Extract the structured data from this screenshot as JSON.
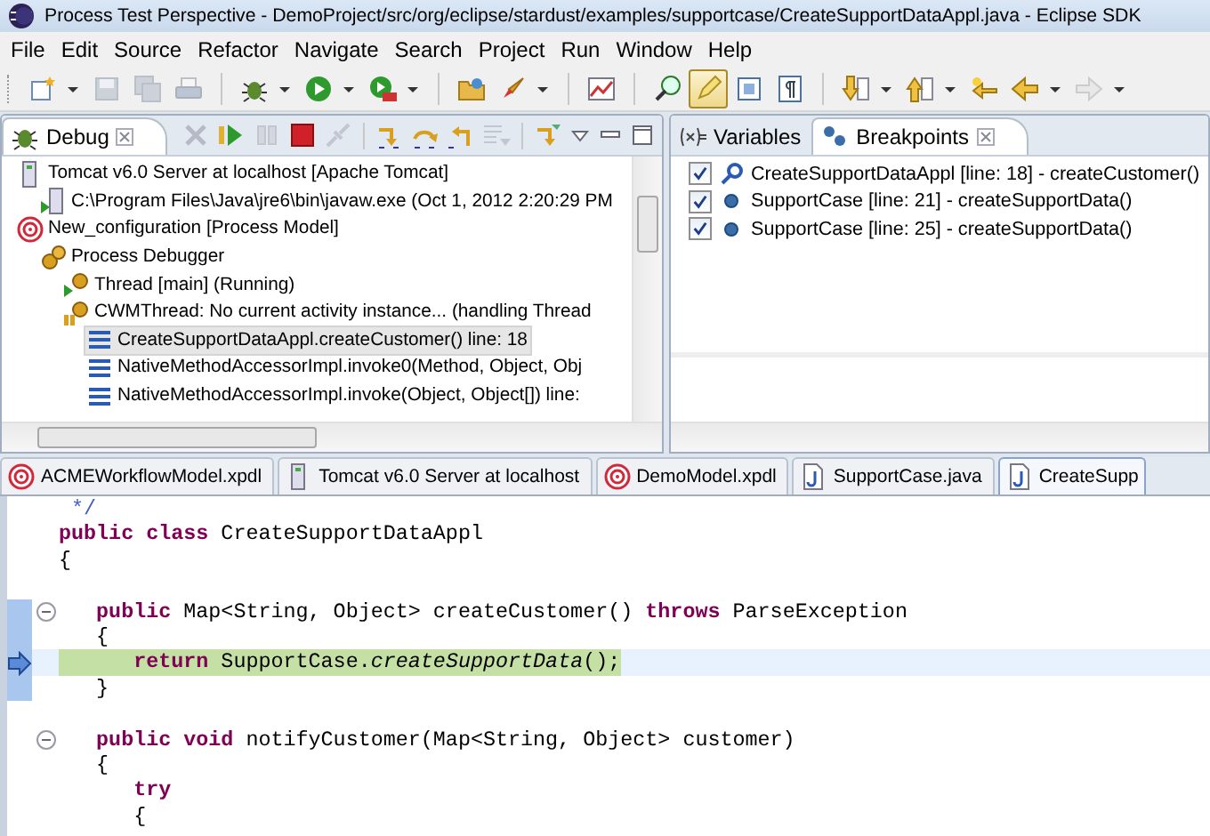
{
  "window": {
    "title": "Process Test Perspective - DemoProject/src/org/eclipse/stardust/examples/supportcase/CreateSupportDataAppl.java - Eclipse SDK"
  },
  "menu": [
    "File",
    "Edit",
    "Source",
    "Refactor",
    "Navigate",
    "Search",
    "Project",
    "Run",
    "Window",
    "Help"
  ],
  "toolbar": [
    {
      "kind": "new",
      "dropdown": true,
      "pressed": false,
      "disabled": false
    },
    {
      "kind": "save",
      "dropdown": false,
      "pressed": false,
      "disabled": true
    },
    {
      "kind": "saveall",
      "dropdown": false,
      "pressed": false,
      "disabled": true
    },
    {
      "kind": "print",
      "dropdown": false,
      "pressed": false,
      "disabled": true
    },
    {
      "kind": "separator"
    },
    {
      "kind": "debug",
      "dropdown": true,
      "pressed": false,
      "disabled": false
    },
    {
      "kind": "run",
      "dropdown": true,
      "pressed": false,
      "disabled": false
    },
    {
      "kind": "external",
      "dropdown": true,
      "pressed": false,
      "disabled": false
    },
    {
      "kind": "separator"
    },
    {
      "kind": "folder",
      "dropdown": false,
      "pressed": false,
      "disabled": false
    },
    {
      "kind": "rocket",
      "dropdown": true,
      "pressed": false,
      "disabled": false
    },
    {
      "kind": "separator"
    },
    {
      "kind": "chart",
      "dropdown": false,
      "pressed": false,
      "disabled": false
    },
    {
      "kind": "separator"
    },
    {
      "kind": "annotation",
      "dropdown": false,
      "pressed": false,
      "disabled": false
    },
    {
      "kind": "pen",
      "dropdown": false,
      "pressed": true,
      "disabled": false
    },
    {
      "kind": "block",
      "dropdown": false,
      "pressed": false,
      "disabled": false
    },
    {
      "kind": "pilcrow",
      "dropdown": false,
      "pressed": false,
      "disabled": false
    },
    {
      "kind": "separator"
    },
    {
      "kind": "next",
      "dropdown": true,
      "pressed": false,
      "disabled": false
    },
    {
      "kind": "prev",
      "dropdown": true,
      "pressed": false,
      "disabled": false
    },
    {
      "kind": "lastedit",
      "dropdown": false,
      "pressed": false,
      "disabled": false
    },
    {
      "kind": "back",
      "dropdown": true,
      "pressed": false,
      "disabled": false
    },
    {
      "kind": "forward",
      "dropdown": true,
      "pressed": false,
      "disabled": true
    }
  ],
  "debug_view": {
    "tab": {
      "label": "Debug",
      "selected": true
    },
    "toolbar": [
      {
        "kind": "removeall",
        "disabled": true
      },
      {
        "kind": "resume",
        "disabled": false
      },
      {
        "kind": "suspend",
        "disabled": true
      },
      {
        "kind": "terminate",
        "disabled": false
      },
      {
        "kind": "disconnect",
        "disabled": true
      },
      {
        "kind": "separator"
      },
      {
        "kind": "stepinto",
        "disabled": false
      },
      {
        "kind": "stepover",
        "disabled": false
      },
      {
        "kind": "stepreturn",
        "disabled": false
      },
      {
        "kind": "dropframe",
        "disabled": true
      },
      {
        "kind": "separator"
      },
      {
        "kind": "stepfilters",
        "disabled": false
      },
      {
        "kind": "viewmenu",
        "disabled": false
      },
      {
        "kind": "minimize",
        "disabled": false
      },
      {
        "kind": "maximize",
        "disabled": false
      }
    ],
    "tree": [
      {
        "label": "Tomcat v6.0 Server at localhost [Apache Tomcat]",
        "kind": "server",
        "selected": false,
        "children": [
          {
            "label": "C:\\Program Files\\Java\\jre6\\bin\\javaw.exe (Oct 1, 2012 2:20:29 PM",
            "kind": "process",
            "selected": false
          }
        ]
      },
      {
        "label": "New_configuration [Process Model]",
        "kind": "model",
        "selected": false,
        "children": [
          {
            "label": "Process Debugger",
            "kind": "debugger",
            "selected": false,
            "children": [
              {
                "label": "Thread [main] (Running)",
                "kind": "running",
                "selected": false
              },
              {
                "label": "CWMThread: No current activity instance... (handling Thread",
                "kind": "suspended",
                "selected": false,
                "children": [
                  {
                    "label": "CreateSupportDataAppl.createCustomer() line: 18",
                    "kind": "frame",
                    "selected": true
                  },
                  {
                    "label": "NativeMethodAccessorImpl.invoke0(Method, Object, Obj",
                    "kind": "frame",
                    "selected": false
                  },
                  {
                    "label": "NativeMethodAccessorImpl.invoke(Object, Object[]) line:",
                    "kind": "frame",
                    "selected": false
                  }
                ]
              }
            ]
          }
        ]
      }
    ]
  },
  "breakpoints_view": {
    "tabs": [
      {
        "label": "Variables",
        "kind": "variables",
        "selected": false
      },
      {
        "label": "Breakpoints",
        "kind": "breakpoints",
        "selected": true
      }
    ],
    "items": [
      {
        "label": "CreateSupportDataAppl [line: 18] - createCustomer()",
        "kind": "hit",
        "checked": true
      },
      {
        "label": "SupportCase [line: 21] - createSupportData()",
        "kind": "line",
        "checked": true
      },
      {
        "label": "SupportCase [line: 25] - createSupportData()",
        "kind": "line",
        "checked": true
      }
    ]
  },
  "editor": {
    "tabs": [
      {
        "label": "ACMEWorkflowModel.xpdl",
        "kind": "model",
        "selected": false
      },
      {
        "label": "Tomcat v6.0 Server at localhost",
        "kind": "server",
        "selected": false
      },
      {
        "label": "DemoModel.xpdl",
        "kind": "model",
        "selected": false
      },
      {
        "label": "SupportCase.java",
        "kind": "java",
        "selected": false
      },
      {
        "label": "CreateSupp",
        "kind": "java",
        "selected": true
      }
    ],
    "lines": [
      {
        "kind": "code",
        "tokens": [
          {
            "text": " */",
            "kind": "comment"
          }
        ]
      },
      {
        "kind": "code",
        "tokens": [
          {
            "text": "public class",
            "kind": "keyword"
          },
          {
            "text": " CreateSupportDataAppl",
            "kind": "plain"
          }
        ]
      },
      {
        "kind": "code",
        "tokens": [
          {
            "text": "{",
            "kind": "plain"
          }
        ]
      },
      {
        "kind": "blank"
      },
      {
        "kind": "code",
        "fold": true,
        "range": true,
        "tokens": [
          {
            "text": "   public",
            "kind": "keyword"
          },
          {
            "text": " Map<String, Object> createCustomer() ",
            "kind": "plain"
          },
          {
            "text": "throws",
            "kind": "keyword"
          },
          {
            "text": " ParseException",
            "kind": "plain"
          }
        ]
      },
      {
        "kind": "code",
        "range": true,
        "tokens": [
          {
            "text": "   {",
            "kind": "plain"
          }
        ]
      },
      {
        "kind": "code",
        "range": true,
        "current": true,
        "tokens": [
          {
            "text": "      return",
            "kind": "keyword"
          },
          {
            "text": " SupportCase.",
            "kind": "plain"
          },
          {
            "text": "createSupportData",
            "kind": "static"
          },
          {
            "text": "();",
            "kind": "plain"
          }
        ]
      },
      {
        "kind": "code",
        "range": true,
        "tokens": [
          {
            "text": "   }",
            "kind": "plain"
          }
        ]
      },
      {
        "kind": "blank"
      },
      {
        "kind": "code",
        "fold": true,
        "tokens": [
          {
            "text": "   public void",
            "kind": "keyword"
          },
          {
            "text": " notifyCustomer(Map<String, Object> customer)",
            "kind": "plain"
          }
        ]
      },
      {
        "kind": "code",
        "tokens": [
          {
            "text": "   {",
            "kind": "plain"
          }
        ]
      },
      {
        "kind": "code",
        "tokens": [
          {
            "text": "      try",
            "kind": "keyword"
          }
        ]
      },
      {
        "kind": "code",
        "tokens": [
          {
            "text": "      {",
            "kind": "plain"
          }
        ]
      }
    ]
  }
}
